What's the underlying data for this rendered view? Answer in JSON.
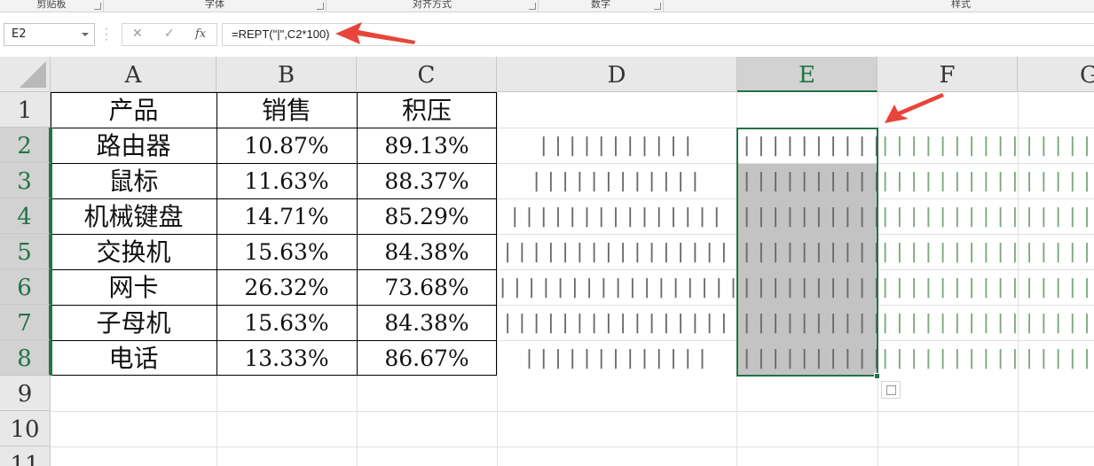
{
  "ribbon": {
    "groups": [
      "剪贴板",
      "字体",
      "对齐方式",
      "数字",
      "样式"
    ]
  },
  "formula_bar": {
    "name_box": "E2",
    "cancel_icon": "✕",
    "enter_icon": "✓",
    "fx_label": "fx",
    "formula": "=REPT(\"|\",C2*100)"
  },
  "columns": [
    "A",
    "B",
    "C",
    "D",
    "E",
    "F",
    "G"
  ],
  "rows": [
    "1",
    "2",
    "3",
    "4",
    "5",
    "6",
    "7",
    "8",
    "9",
    "10",
    "11"
  ],
  "table": {
    "headers": [
      "产品",
      "销售",
      "积压"
    ],
    "rows": [
      {
        "product": "路由器",
        "sales": "10.87%",
        "stock": "89.13%",
        "sales_value": 0.1087,
        "stock_value": 0.8913
      },
      {
        "product": "鼠标",
        "sales": "11.63%",
        "stock": "88.37%",
        "sales_value": 0.1163,
        "stock_value": 0.8837
      },
      {
        "product": "机械键盘",
        "sales": "14.71%",
        "stock": "85.29%",
        "sales_value": 0.1471,
        "stock_value": 0.8529
      },
      {
        "product": "交换机",
        "sales": "15.63%",
        "stock": "84.38%",
        "sales_value": 0.1563,
        "stock_value": 0.8438
      },
      {
        "product": "网卡",
        "sales": "26.32%",
        "stock": "73.68%",
        "sales_value": 0.2632,
        "stock_value": 0.7368
      },
      {
        "product": "子母机",
        "sales": "15.63%",
        "stock": "84.38%",
        "sales_value": 0.1563,
        "stock_value": 0.8438
      },
      {
        "product": "电话",
        "sales": "13.33%",
        "stock": "86.67%",
        "sales_value": 0.1333,
        "stock_value": 0.8667
      }
    ]
  },
  "colors": {
    "accent": "#217346",
    "arrow": "#e8443a"
  }
}
